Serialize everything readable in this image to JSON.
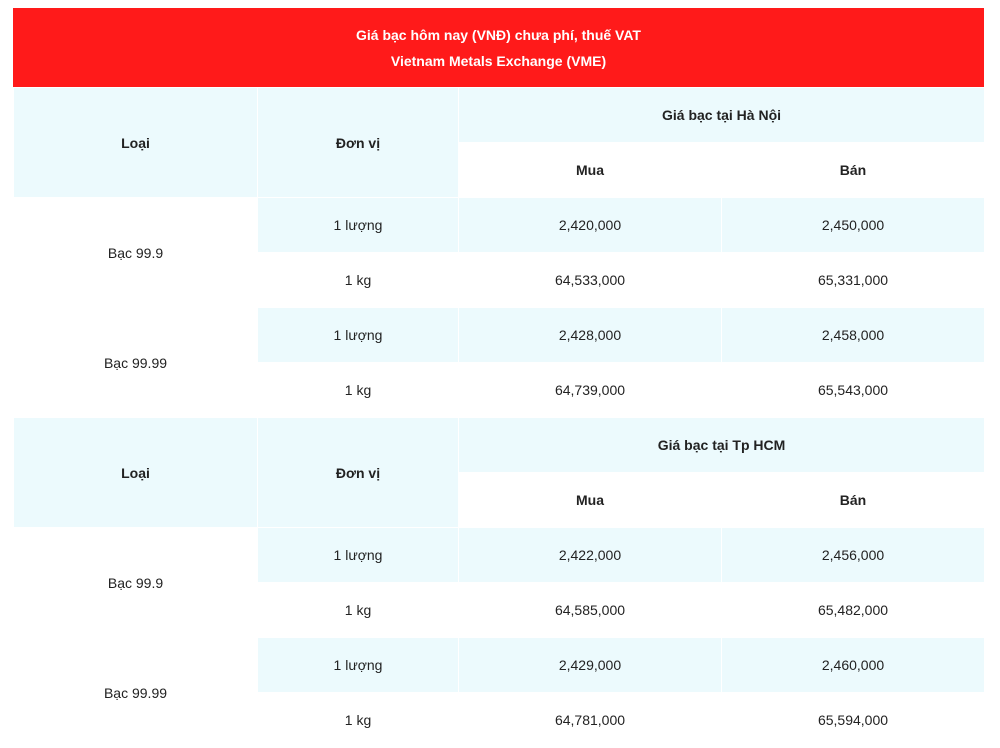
{
  "title_line1": "Giá bạc hôm nay (VNĐ) chưa phí, thuế VAT",
  "title_line2": "Vietnam Metals Exchange (VME)",
  "headers": {
    "loai": "Loại",
    "don_vi": "Đơn vị",
    "mua": "Mua",
    "ban": "Bán"
  },
  "sections": [
    {
      "location_label": "Giá bạc tại Hà Nội",
      "groups": [
        {
          "type": "Bạc 99.9",
          "rows": [
            {
              "unit": "1 lượng",
              "buy": "2,420,000",
              "sell": "2,450,000"
            },
            {
              "unit": "1 kg",
              "buy": "64,533,000",
              "sell": "65,331,000"
            }
          ]
        },
        {
          "type": "Bạc 99.99",
          "rows": [
            {
              "unit": "1 lượng",
              "buy": "2,428,000",
              "sell": "2,458,000"
            },
            {
              "unit": "1 kg",
              "buy": "64,739,000",
              "sell": "65,543,000"
            }
          ]
        }
      ]
    },
    {
      "location_label": "Giá bạc tại Tp HCM",
      "groups": [
        {
          "type": "Bạc 99.9",
          "rows": [
            {
              "unit": "1 lượng",
              "buy": "2,422,000",
              "sell": "2,456,000"
            },
            {
              "unit": "1 kg",
              "buy": "64,585,000",
              "sell": "65,482,000"
            }
          ]
        },
        {
          "type": "Bạc 99.99",
          "rows": [
            {
              "unit": "1 lượng",
              "buy": "2,429,000",
              "sell": "2,460,000"
            },
            {
              "unit": "1 kg",
              "buy": "64,781,000",
              "sell": "65,594,000"
            }
          ]
        }
      ]
    }
  ],
  "colors": {
    "banner": "#ff1a1a",
    "header_bg": "#ecfafd",
    "row_alt": "#ecfafd"
  }
}
